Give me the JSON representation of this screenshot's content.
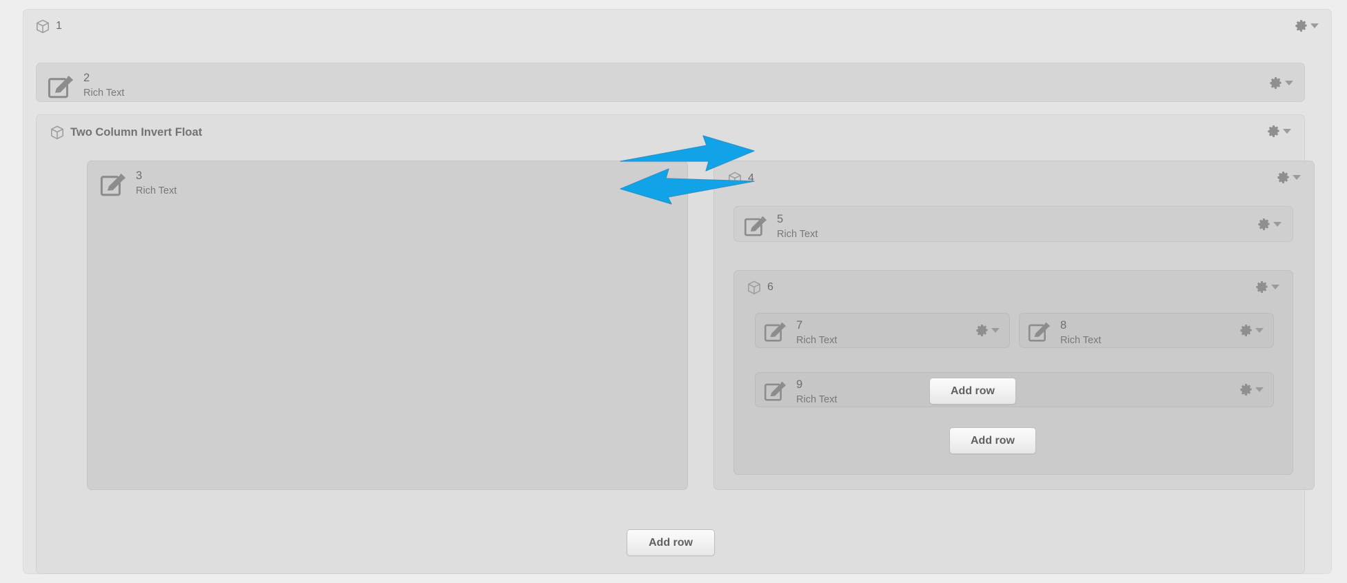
{
  "colors": {
    "page_background": "#eeeeee",
    "panel_level0": "#e4e4e4",
    "panel_level1": "#dedede",
    "panel_level2": "#d4d4d4",
    "tile": "#d6d6d6",
    "arrow_blue": "#10a3e8",
    "label_text": "#6b6b6b",
    "button_text": "#5f5f5f"
  },
  "icons": {
    "cube": "cube-icon",
    "pencil": "edit-pencil-icon",
    "gear": "gear-icon",
    "caret": "chevron-down-icon"
  },
  "blocks": {
    "root": {
      "label": "1",
      "icon": "cube-icon"
    },
    "b2": {
      "label": "2",
      "type": "Rich Text",
      "icon": "edit-pencil-icon"
    },
    "two_column": {
      "label": "Two Column Invert Float",
      "icon": "cube-icon"
    },
    "b3": {
      "label": "3",
      "type": "Rich Text",
      "icon": "edit-pencil-icon"
    },
    "b4": {
      "label": "4",
      "icon": "cube-icon"
    },
    "b5": {
      "label": "5",
      "type": "Rich Text",
      "icon": "edit-pencil-icon"
    },
    "b6": {
      "label": "6",
      "icon": "cube-icon"
    },
    "b7": {
      "label": "7",
      "type": "Rich Text",
      "icon": "edit-pencil-icon"
    },
    "b8": {
      "label": "8",
      "type": "Rich Text",
      "icon": "edit-pencil-icon"
    },
    "b9": {
      "label": "9",
      "type": "Rich Text",
      "icon": "edit-pencil-icon"
    }
  },
  "buttons": {
    "add_row_inner": "Add row",
    "add_row_column": "Add row",
    "add_row_outer": "Add row"
  },
  "annotations": {
    "arrow_right": "right-arrow-annotation",
    "arrow_left": "left-arrow-annotation"
  }
}
